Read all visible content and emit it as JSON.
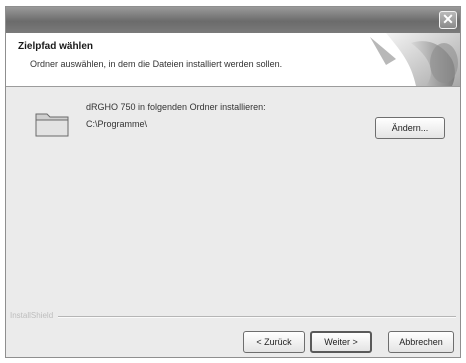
{
  "window": {
    "close_glyph": "✕"
  },
  "header": {
    "title": "Zielpfad wählen",
    "subtitle": "Ordner auswählen, in dem die Dateien installiert werden sollen."
  },
  "install": {
    "message": "dRGHO 750 in folgenden Ordner installieren:",
    "path": "C:\\Programme\\",
    "change_label": "Ändern..."
  },
  "footer": {
    "brand": "InstallShield",
    "back_label": "< Zurück",
    "next_label": "Weiter >",
    "cancel_label": "Abbrechen"
  },
  "icons": {
    "folder": "folder-icon",
    "close": "close-icon",
    "header_art": "header-graphic-icon"
  },
  "colors": {
    "window_bg": "#ebebeb",
    "titlebar": "#7a7a7a",
    "header_bg": "#ffffff"
  }
}
